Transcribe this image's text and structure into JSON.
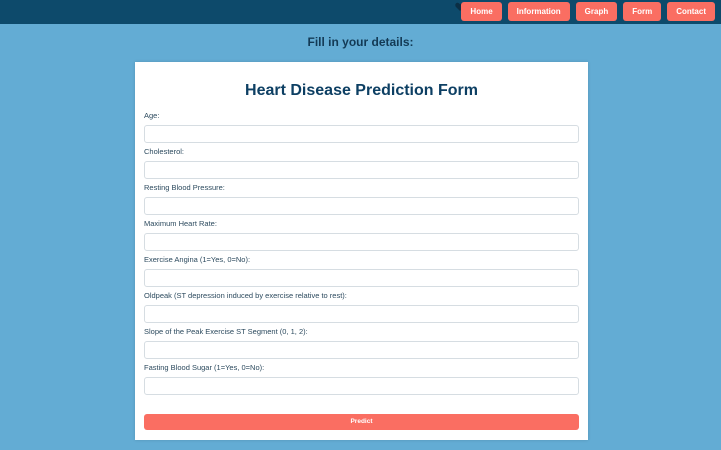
{
  "colors": {
    "navbar": "#0d4a6b",
    "background": "#63acd4",
    "accent": "#fa6e62",
    "title": "#0d3f63"
  },
  "nav": {
    "icon": "heart-icon",
    "items": [
      {
        "label": "Home"
      },
      {
        "label": "Information"
      },
      {
        "label": "Graph"
      },
      {
        "label": "Form"
      },
      {
        "label": "Contact"
      }
    ]
  },
  "page": {
    "heading": "Fill in your details:"
  },
  "form": {
    "title": "Heart Disease Prediction Form",
    "fields": [
      {
        "label": "Age:",
        "value": "",
        "placeholder": ""
      },
      {
        "label": "Cholesterol:",
        "value": "",
        "placeholder": ""
      },
      {
        "label": "Resting Blood Pressure:",
        "value": "",
        "placeholder": ""
      },
      {
        "label": "Maximum Heart Rate:",
        "value": "",
        "placeholder": ""
      },
      {
        "label": "Exercise Angina (1=Yes, 0=No):",
        "value": "",
        "placeholder": ""
      },
      {
        "label": "Oldpeak (ST depression induced by exercise relative to rest):",
        "value": "",
        "placeholder": ""
      },
      {
        "label": "Slope of the Peak Exercise ST Segment (0, 1, 2):",
        "value": "",
        "placeholder": ""
      },
      {
        "label": "Fasting Blood Sugar (1=Yes, 0=No):",
        "value": "",
        "placeholder": ""
      }
    ],
    "submit_label": "Predict"
  }
}
